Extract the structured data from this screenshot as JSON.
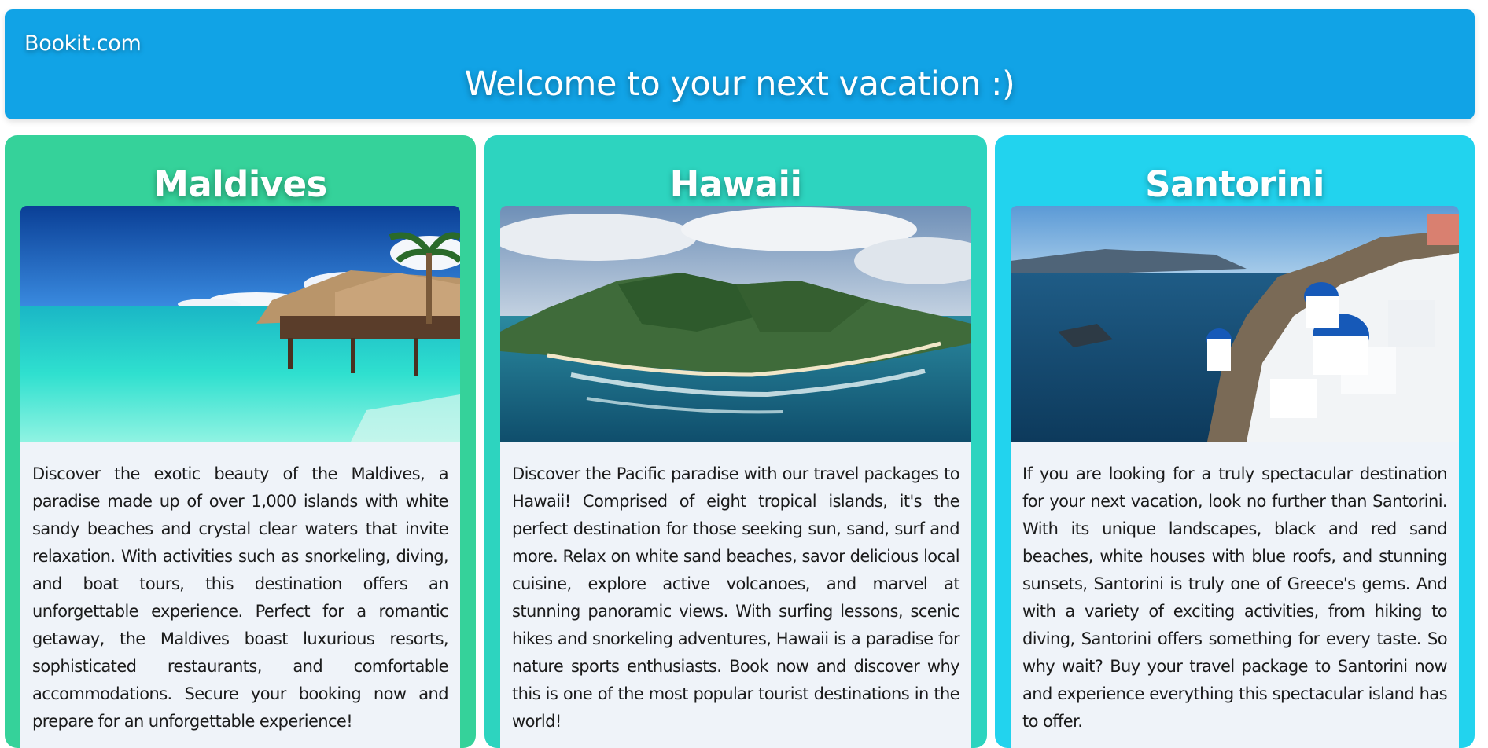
{
  "header": {
    "brand": "Bookit.com",
    "headline": "Welcome to your next vacation :)",
    "color": "#11a3e6"
  },
  "cards": [
    {
      "title": "Maldives",
      "background": "#35d29a",
      "image_alt": "overwater bungalows above turquoise lagoon",
      "description": "Discover the exotic beauty of the Maldives, a paradise made up of over 1,000 islands with white sandy beaches and crystal clear waters that invite relaxation. With activities such as snorkeling, diving, and boat tours, this destination offers an unforgettable experience. Perfect for a romantic getaway, the Maldives boast luxurious resorts, sophisticated restaurants, and comfortable accommodations. Secure your booking now and prepare for an unforgettable experience!"
    },
    {
      "title": "Hawaii",
      "background": "#2dd4bf",
      "image_alt": "green mountainous island coastline with reef",
      "description": "Discover the Pacific paradise with our travel packages to Hawaii! Comprised of eight tropical islands, it's the perfect destination for those seeking sun, sand, surf and more. Relax on white sand beaches, savor delicious local cuisine, explore active volcanoes, and marvel at stunning panoramic views. With surfing lessons, scenic hikes and snorkeling adventures, Hawaii is a paradise for nature sports enthusiasts. Book now and discover why this is one of the most popular tourist destinations in the world!"
    },
    {
      "title": "Santorini",
      "background": "#22d3ee",
      "image_alt": "white houses with blue domes above the caldera sea",
      "description": "If you are looking for a truly spectacular destination for your next vacation, look no further than Santorini. With its unique landscapes, black and red sand beaches, white houses with blue roofs, and stunning sunsets, Santorini is truly one of Greece's gems. And with a variety of exciting activities, from hiking to diving, Santorini offers something for every taste. So why wait? Buy your travel package to Santorini now and experience everything this spectacular island has to offer."
    }
  ]
}
